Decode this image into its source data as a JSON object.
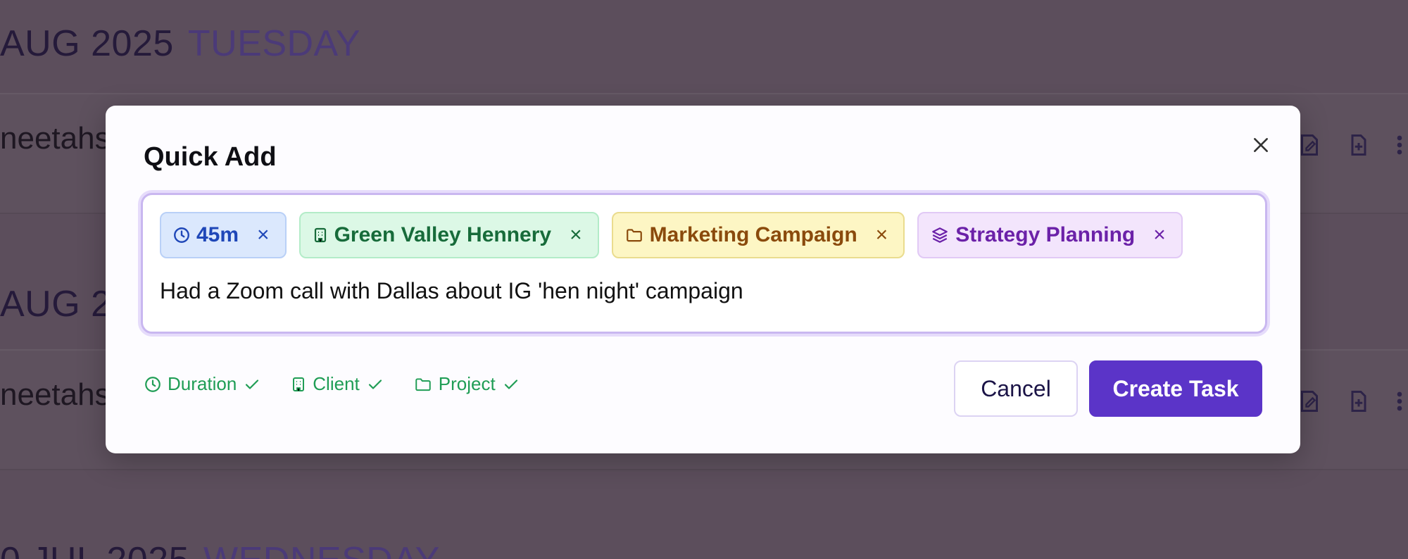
{
  "background": {
    "day_headers": [
      {
        "date": "AUG 2025",
        "weekday": "TUESDAY"
      },
      {
        "date": "AUG 2",
        "weekday": ""
      },
      {
        "date": "0 JUL 2025",
        "weekday": "WEDNESDAY"
      }
    ],
    "entries": [
      {
        "text": "neetahs"
      },
      {
        "text": "neetahs"
      }
    ],
    "row_action_icons": [
      "edit-note-icon",
      "file-add-icon",
      "more-vertical-icon"
    ]
  },
  "dialog": {
    "title": "Quick Add",
    "close_icon": "close-icon",
    "chips": [
      {
        "kind": "duration",
        "label": "45m",
        "icon": "clock-icon"
      },
      {
        "kind": "client",
        "label": "Green Valley Hennery",
        "icon": "building-icon"
      },
      {
        "kind": "project",
        "label": "Marketing Campaign",
        "icon": "folder-icon"
      },
      {
        "kind": "activity",
        "label": "Strategy Planning",
        "icon": "layers-icon"
      }
    ],
    "chip_remove_glyph": "×",
    "task_text": "Had a Zoom call with Dallas about IG 'hen night' campaign",
    "detected": [
      {
        "label": "Duration",
        "icon": "clock-icon"
      },
      {
        "label": "Client",
        "icon": "building-icon"
      },
      {
        "label": "Project",
        "icon": "folder-icon"
      }
    ],
    "cancel_label": "Cancel",
    "create_label": "Create Task"
  },
  "colors": {
    "overlay": "#5c4e5c",
    "primary": "#5b34c8",
    "detected_green": "#1f9d55"
  }
}
